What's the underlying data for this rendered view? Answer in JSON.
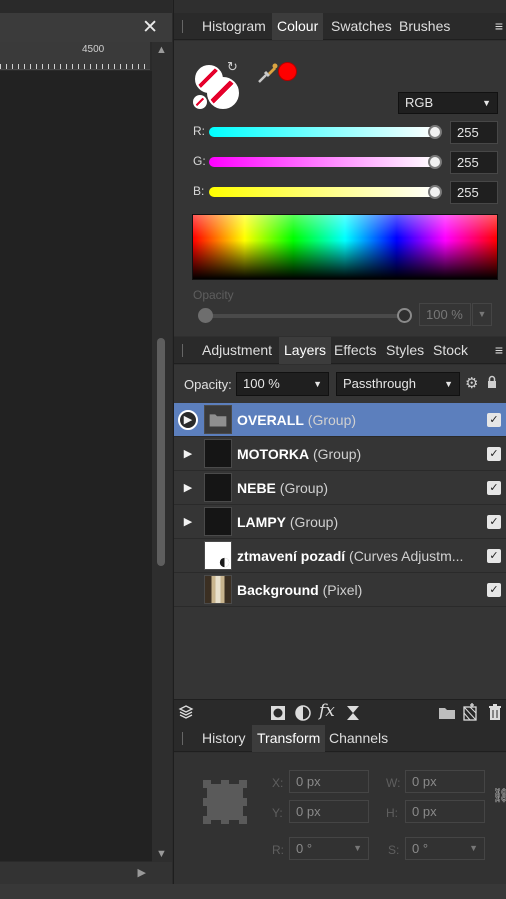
{
  "canvas": {
    "close_glyph": "✕",
    "ruler_label": "4500",
    "scroll_up": "▲",
    "scroll_down": "▼",
    "scroll_right": "▶"
  },
  "colour_panel": {
    "tabs": [
      "Histogram",
      "Colour",
      "Swatches",
      "Brushes"
    ],
    "active_tab": "Colour",
    "menu_glyph": "≡",
    "current_colour": "#ff0000",
    "model": "RGB",
    "sliders": [
      {
        "label": "R:",
        "value": "255",
        "level": 1.0,
        "gradient": "linear-gradient(to right, #00ffff, #ffffff)"
      },
      {
        "label": "G:",
        "value": "255",
        "level": 1.0,
        "gradient": "linear-gradient(to right, #ff00ff, #ffffff)"
      },
      {
        "label": "B:",
        "value": "255",
        "level": 1.0,
        "gradient": "linear-gradient(to right, #ffff00, #ffffff)"
      }
    ],
    "opacity_label": "Opacity",
    "opacity_value": "100 %"
  },
  "layers_panel": {
    "tabs": [
      "Adjustment",
      "Layers",
      "Effects",
      "Styles",
      "Stock"
    ],
    "active_tab": "Layers",
    "opacity_label": "Opacity:",
    "opacity_value": "100 %",
    "blend_mode": "Passthrough",
    "accent": "#5c7fbd",
    "layers": [
      {
        "name": "OVERALL",
        "type": "(Group)",
        "expandable": true,
        "selected": true,
        "visible": true,
        "thumb": "folder"
      },
      {
        "name": "MOTORKA",
        "type": "(Group)",
        "expandable": true,
        "selected": false,
        "visible": true,
        "thumb": "dark"
      },
      {
        "name": "NEBE",
        "type": "(Group)",
        "expandable": true,
        "selected": false,
        "visible": true,
        "thumb": "dark"
      },
      {
        "name": "LAMPY",
        "type": "(Group)",
        "expandable": true,
        "selected": false,
        "visible": true,
        "thumb": "dark"
      },
      {
        "name": "ztmavení pozadí",
        "type": "(Curves Adjustm...",
        "expandable": false,
        "selected": false,
        "visible": true,
        "thumb": "curves"
      },
      {
        "name": "Background",
        "type": "(Pixel)",
        "expandable": false,
        "selected": false,
        "visible": true,
        "thumb": "photo"
      }
    ],
    "toolbar_icons": [
      "layers-icon",
      "mask-icon",
      "adjustment-icon",
      "fx-icon",
      "hourglass-icon",
      "folder-icon",
      "new-layer-icon",
      "trash-icon"
    ]
  },
  "transform_panel": {
    "tabs": [
      "History",
      "Transform",
      "Channels"
    ],
    "active_tab": "Transform",
    "fields": {
      "x_label": "X:",
      "x_value": "0 px",
      "y_label": "Y:",
      "y_value": "0 px",
      "w_label": "W:",
      "w_value": "0 px",
      "h_label": "H:",
      "h_value": "0 px",
      "r_label": "R:",
      "r_value": "0 °",
      "s_label": "S:",
      "s_value": "0 °"
    }
  }
}
